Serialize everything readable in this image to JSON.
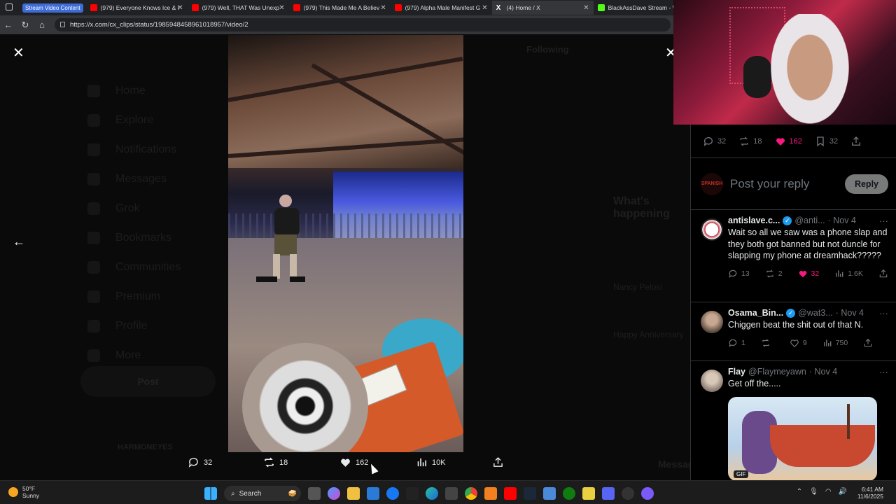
{
  "browser": {
    "tab_group": "Stream Video Content",
    "tabs": [
      {
        "label": "(979) Everyone Knows Ice & I",
        "icon": "youtube-icon",
        "color": "#ff0000"
      },
      {
        "label": "(979) Well, THAT Was Unexp",
        "icon": "youtube-icon",
        "color": "#ff0000"
      },
      {
        "label": "(979) This Made Me A Believ",
        "icon": "youtube-icon",
        "color": "#ff0000"
      },
      {
        "label": "(979) Alpha Male Manifest G",
        "icon": "youtube-icon",
        "color": "#ff0000"
      },
      {
        "label": "(4) Home / X",
        "icon": "x-icon",
        "color": "#ffffff"
      },
      {
        "label": "BlackAssDave Stream - Wa",
        "icon": "kick-icon",
        "color": "#53fc18"
      }
    ],
    "url": "https://x.com/cx_clips/status/1985948458961018957/video/2"
  },
  "viewer": {
    "background_ghost": {
      "sidebar": [
        "Home",
        "Explore",
        "Notifications",
        "Messages",
        "Grok",
        "Bookmarks",
        "Communities",
        "Premium",
        "Profile",
        "More"
      ],
      "post_button": "Post",
      "following": "Following",
      "whats_happening": "What's happening",
      "trend1": "Nancy Pelosi",
      "trend2": "Happy Anniversary",
      "user_bottom": "HARMONEYES",
      "messages": "Messages"
    },
    "actions": {
      "replies": "32",
      "reposts": "18",
      "likes": "162",
      "views": "10K"
    }
  },
  "panel": {
    "stats": {
      "replies": "32",
      "reposts": "18",
      "likes": "162",
      "bookmarks": "32"
    },
    "reply_placeholder": "Post your reply",
    "reply_button": "Reply",
    "reply_avatar_text": "SPANISH",
    "tweets": [
      {
        "name": "antislave.c...",
        "verified": true,
        "handle": "@anti...",
        "date": "· Nov 4",
        "text": "Wait so all we saw was a phone slap and they both got banned but not duncle for slapping my phone at dreamhack?????",
        "replies": "13",
        "reposts": "2",
        "likes": "32",
        "views": "1.6K",
        "liked": true
      },
      {
        "name": "Osama_Bin...",
        "verified": true,
        "handle": "@wat3...",
        "date": "· Nov 4",
        "text": "Chiggen beat the shit out of that N.",
        "replies": "1",
        "reposts": "",
        "likes": "9",
        "views": "750",
        "liked": false
      },
      {
        "name": "Flay",
        "verified": false,
        "handle": "@Flaymeyawn",
        "date": "· Nov 4",
        "text": "Get off the.....",
        "gif_badge": "GIF"
      }
    ]
  },
  "taskbar": {
    "temp": "50°F",
    "condition": "Sunny",
    "search": "Search",
    "time": "6:41 AM",
    "date": "11/6/2025"
  },
  "colors": {
    "accent": "#1d9bf0",
    "like": "#f91880"
  }
}
